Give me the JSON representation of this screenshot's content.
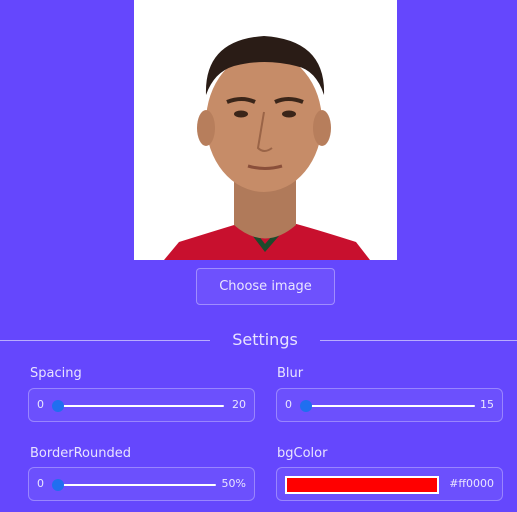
{
  "image": {
    "alt": "profile photo"
  },
  "upload": {
    "button_label": "Choose image"
  },
  "settings": {
    "title": "Settings",
    "spacing": {
      "label": "Spacing",
      "min": "0",
      "max": "20",
      "value": 0
    },
    "blur": {
      "label": "Blur",
      "min": "0",
      "max": "15",
      "value": 0
    },
    "border_rounded": {
      "label": "BorderRounded",
      "min": "0",
      "max": "50%",
      "value": 0
    },
    "bg_color": {
      "label": "bgColor",
      "value": "#ff0000",
      "swatch": "#ff0000"
    }
  },
  "colors": {
    "background": "#6547fd",
    "thumb": "#1f6ff0"
  }
}
